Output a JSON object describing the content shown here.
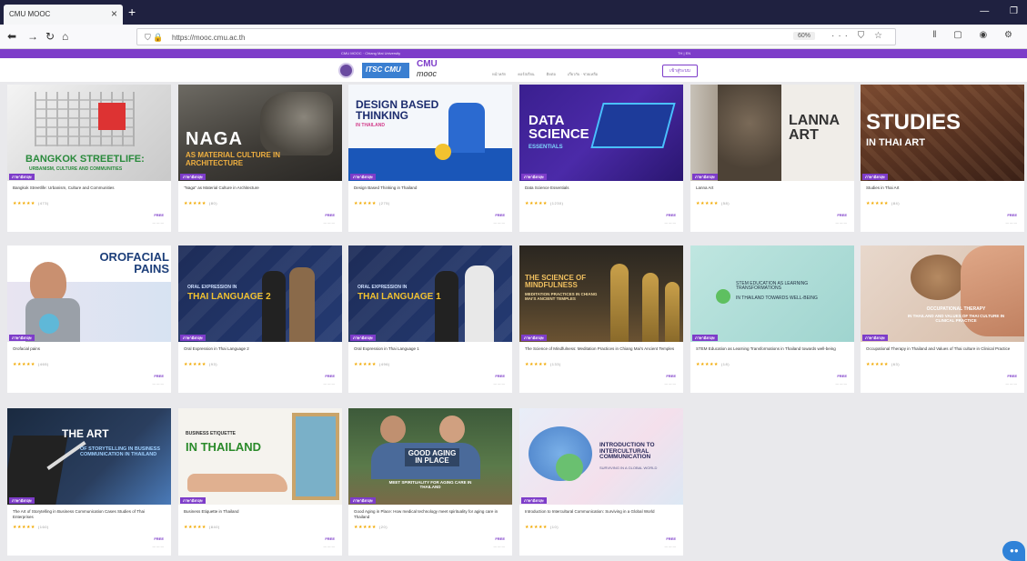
{
  "browser": {
    "tab_title": "CMU MOOC",
    "url": "https://mooc.cmu.ac.th",
    "zoom": "60%"
  },
  "site": {
    "top_strip_left": "CMU MOOC · Chiang Mai University",
    "top_strip_right": "TH | EN",
    "logo_a": "ITSC CMU",
    "logo_b": "CMU",
    "logo_b_sub": "mooc",
    "nav": [
      "หน้าหลัก",
      "คอร์สเรียน",
      "ติดต่อ",
      "เกี่ยวกับ · ช่วยเหลือ"
    ],
    "lang_button": "เข้าสู่ระบบ"
  },
  "courses": [
    {
      "thumb_title": "BANGKOK STREETLIFE:",
      "thumb_sub": "URBANISM, CULTURE AND COMMUNITIES",
      "title": "Bangkok Streetlife: Urbanism, Culture and Communities",
      "rating": "(473)",
      "price": "FREE",
      "badge": "ภาษาอังกฤษ"
    },
    {
      "thumb_title": "NAGA",
      "thumb_sub": "AS MATERIAL CULTURE IN ARCHITECTURE",
      "title": "\"Naga\" as Material Culture in Architecture",
      "rating": "(80)",
      "price": "FREE",
      "badge": "ภาษาอังกฤษ"
    },
    {
      "thumb_title": "DESIGN BASED THINKING",
      "thumb_sub": "IN THAILAND",
      "title": "Design Based Thinking in Thailand",
      "rating": "(275)",
      "price": "FREE",
      "badge": "ภาษาอังกฤษ"
    },
    {
      "thumb_title": "DATA SCIENCE",
      "thumb_sub": "ESSENTIALS",
      "title": "Data Science Essentials",
      "rating": "(1230)",
      "price": "FREE",
      "badge": "ภาษาอังกฤษ"
    },
    {
      "thumb_title": "LANNA ART",
      "thumb_sub": "",
      "title": "Lanna Art",
      "rating": "(58)",
      "price": "FREE",
      "badge": "ภาษาอังกฤษ"
    },
    {
      "thumb_title": "STUDIES",
      "thumb_sub": "IN THAI ART",
      "title": "Studies in Thai Art",
      "rating": "(84)",
      "price": "FREE",
      "badge": "ภาษาอังกฤษ"
    },
    {
      "thumb_title": "OROFACIAL PAINS",
      "thumb_sub": "",
      "title": "Orofacial pains",
      "rating": "(465)",
      "price": "FREE",
      "badge": "ภาษาอังกฤษ"
    },
    {
      "thumb_title": "THAI LANGUAGE 2",
      "thumb_sub": "ORAL EXPRESSION IN",
      "title": "Oral Expression in Thai Language 2",
      "rating": "(93)",
      "price": "FREE",
      "badge": "ภาษาอังกฤษ"
    },
    {
      "thumb_title": "THAI LANGUAGE 1",
      "thumb_sub": "ORAL EXPRESSION IN",
      "title": "Oral Expression in Thai Language 1",
      "rating": "(496)",
      "price": "FREE",
      "badge": "ภาษาอังกฤษ"
    },
    {
      "thumb_title": "THE SCIENCE OF MINDFULNESS",
      "thumb_sub": "MEDITATION PRACTICES IN CHIANG MAI'S ANCIENT TEMPLES",
      "title": "The Science of Mindfulness: Meditation Practices in Chiang Mai's Ancient Temples",
      "rating": "(133)",
      "price": "FREE",
      "badge": "ภาษาอังกฤษ"
    },
    {
      "thumb_title": "STEM EDUCATION AS LEARNING TRANSFORMATIONS",
      "thumb_sub": "IN THAILAND TOWARDS WELL-BEING",
      "title": "STEM Education as Learning Transformations in Thailand towards well-being",
      "rating": "(18)",
      "price": "FREE",
      "badge": "ภาษาอังกฤษ"
    },
    {
      "thumb_title": "OCCUPATIONAL THERAPY",
      "thumb_sub": "IN THAILAND AND VALUES OF THAI CULTURE IN CLINICAL PRACTICE",
      "title": "Occupational Therapy in Thailand and Values of Thai culture in Clinical Practice",
      "rating": "(63)",
      "price": "FREE",
      "badge": "ภาษาอังกฤษ"
    },
    {
      "thumb_title": "THE ART",
      "thumb_sub": "OF STORYTELLING IN BUSINESS COMMUNICATION IN THAILAND",
      "title": "The Art of Storytelling in Business Communication Cases Studies of Thai Enterprises",
      "rating": "(160)",
      "price": "FREE",
      "badge": "ภาษาอังกฤษ"
    },
    {
      "thumb_title": "IN THAILAND",
      "thumb_sub": "BUSINESS ETIQUETTE",
      "title": "Business Etiquette in Thailand",
      "rating": "(840)",
      "price": "FREE",
      "badge": "ภาษาอังกฤษ"
    },
    {
      "thumb_title": "GOOD AGING IN PLACE",
      "thumb_sub": "MEET SPIRITUALITY FOR AGING CARE IN THAILAND",
      "title": "Good Aging in Place: How medical technology meet spirituality for aging care in Thailand",
      "rating": "(20)",
      "price": "FREE",
      "badge": "ภาษาอังกฤษ"
    },
    {
      "thumb_title": "INTRODUCTION TO INTERCULTURAL COMMUNICATION",
      "thumb_sub": "SURVIVING IN A GLOBAL WORLD",
      "title": "Introduction to Intercultural Communication: Surviving in a Global World",
      "rating": "(10)",
      "price": "FREE",
      "badge": "ภาษาอังกฤษ"
    }
  ],
  "colors": {
    "brand": "#7d3cc9",
    "star": "#f2a900",
    "chrome": "#1f2140"
  },
  "icons": [
    "back-icon",
    "forward-icon",
    "reload-icon",
    "home-icon",
    "lock-icon",
    "bookmark-star-icon",
    "library-icon",
    "chat-icon"
  ]
}
